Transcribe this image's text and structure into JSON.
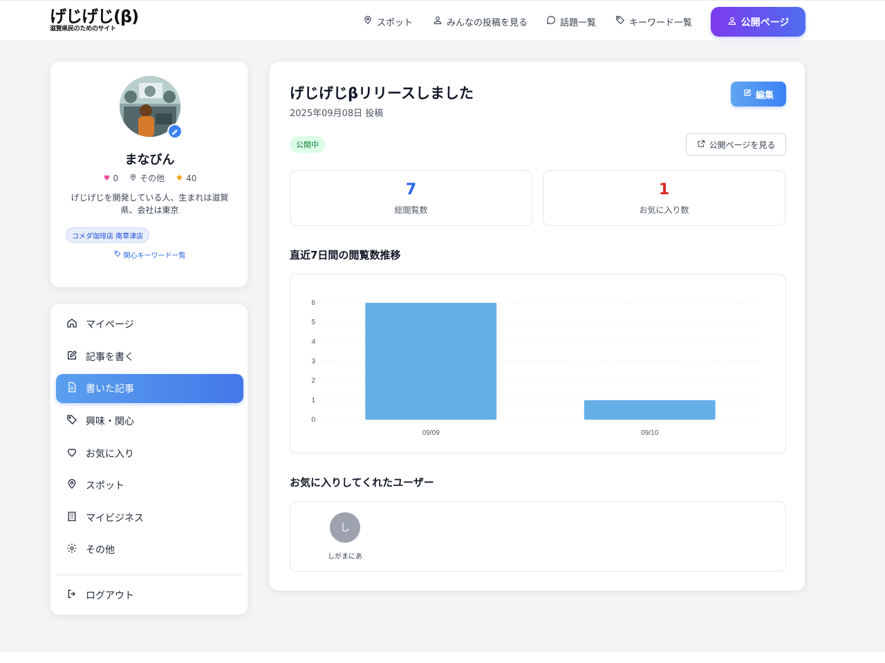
{
  "header": {
    "logo": "げじげじ(β)",
    "logo_sub": "滋賀県民のためのサイト",
    "nav": [
      {
        "label": "スポット",
        "icon": "map-pin-icon"
      },
      {
        "label": "みんなの投稿を見る",
        "icon": "users-icon"
      },
      {
        "label": "話題一覧",
        "icon": "chat-icon"
      },
      {
        "label": "キーワード一覧",
        "icon": "tag-icon"
      }
    ],
    "public_page_label": "公開ページ"
  },
  "profile": {
    "name": "まなびん",
    "likes": "0",
    "location": "その他",
    "points": "40",
    "bio": "げじげじを開発している人、生まれは滋賀県、会社は東京",
    "tag": "コメダ珈琲店 南草津店",
    "keyword_link": "関心キーワード一覧"
  },
  "menu": {
    "items": [
      {
        "label": "マイページ",
        "icon": "home-icon"
      },
      {
        "label": "記事を書く",
        "icon": "edit-icon"
      },
      {
        "label": "書いた記事",
        "icon": "document-icon",
        "active": true
      },
      {
        "label": "興味・関心",
        "icon": "tag-icon"
      },
      {
        "label": "お気に入り",
        "icon": "heart-icon"
      },
      {
        "label": "スポット",
        "icon": "map-pin-icon"
      },
      {
        "label": "マイビジネス",
        "icon": "building-icon"
      },
      {
        "label": "その他",
        "icon": "gear-icon"
      }
    ],
    "logout": "ログアウト"
  },
  "article": {
    "title": "げじげじβリリースしました",
    "date": "2025年09月08日 投稿",
    "edit_label": "編集",
    "status": "公開中",
    "view_public_label": "公開ページを見る",
    "total_views": "7",
    "total_views_label": "総閲覧数",
    "favorites": "1",
    "favorites_label": "お気に入り数",
    "chart_title": "直近7日間の閲覧数推移",
    "fav_users_title": "お気に入りしてくれたユーザー",
    "fav_users": [
      {
        "initial": "し",
        "name": "しがまにあ"
      }
    ]
  },
  "colors": {
    "accent": "#3b82f6",
    "views": "#2563eb",
    "favorites": "#dc2626",
    "bar": "#64afe6"
  },
  "chart_data": {
    "type": "bar",
    "categories": [
      "09/09",
      "09/10"
    ],
    "values": [
      6,
      1
    ],
    "title": "直近7日間の閲覧数推移",
    "xlabel": "",
    "ylabel": "",
    "ylim": [
      0,
      6
    ],
    "yticks": [
      0,
      1,
      2,
      3,
      4,
      5,
      6
    ],
    "grid": true
  }
}
